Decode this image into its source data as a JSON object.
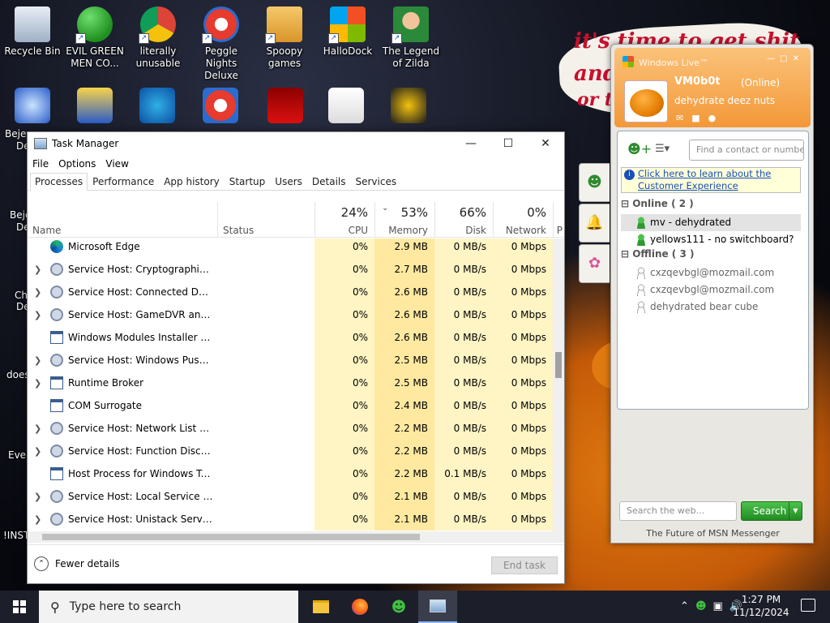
{
  "desktop": {
    "icons": [
      {
        "label": "Recycle Bin",
        "icon": "recycle-bin-icon"
      },
      {
        "label": "EVIL GREEN MEN CO...",
        "icon": "msn-buddies-icon"
      },
      {
        "label": "literally unusable",
        "icon": "chrome-icon"
      },
      {
        "label": "Peggle Nights Deluxe",
        "icon": "peggle-icon"
      },
      {
        "label": "Spoopy games",
        "icon": "folder-icon"
      },
      {
        "label": "HalloDock",
        "icon": "windows-logo-icon"
      },
      {
        "label": "The Legend of Zilda",
        "icon": "zilda-icon"
      }
    ],
    "partial_labels": [
      "Beje",
      "De",
      "Beje",
      "De",
      "Ch",
      "De",
      "does",
      "Ever",
      "!INST"
    ],
    "wallpaper_text": [
      "it's time to get shit",
      "and",
      "or t"
    ]
  },
  "task_manager": {
    "title": "Task Manager",
    "menu": [
      "File",
      "Options",
      "View"
    ],
    "tabs": [
      "Processes",
      "Performance",
      "App history",
      "Startup",
      "Users",
      "Details",
      "Services"
    ],
    "active_tab": "Processes",
    "columns": {
      "name": "Name",
      "status": "Status",
      "cpu": {
        "pct": "24%",
        "label": "CPU"
      },
      "memory": {
        "pct": "53%",
        "label": "Memory"
      },
      "disk": {
        "pct": "66%",
        "label": "Disk"
      },
      "network": {
        "pct": "0%",
        "label": "Network"
      },
      "power_partial": "P"
    },
    "rows": [
      {
        "name": "Microsoft Edge",
        "icon": "edge-icon",
        "expandable": false,
        "cpu": "0%",
        "memory": "2.9 MB",
        "disk": "0 MB/s",
        "network": "0 Mbps"
      },
      {
        "name": "Service Host: Cryptographic Ser...",
        "icon": "gear-icon",
        "expandable": true,
        "cpu": "0%",
        "memory": "2.7 MB",
        "disk": "0 MB/s",
        "network": "0 Mbps"
      },
      {
        "name": "Service Host: Connected Device...",
        "icon": "gear-icon",
        "expandable": true,
        "cpu": "0%",
        "memory": "2.6 MB",
        "disk": "0 MB/s",
        "network": "0 Mbps"
      },
      {
        "name": "Service Host: GameDVR and Bro...",
        "icon": "gear-icon",
        "expandable": true,
        "cpu": "0%",
        "memory": "2.6 MB",
        "disk": "0 MB/s",
        "network": "0 Mbps"
      },
      {
        "name": "Windows Modules Installer Wor...",
        "icon": "window-icon",
        "expandable": false,
        "cpu": "0%",
        "memory": "2.6 MB",
        "disk": "0 MB/s",
        "network": "0 Mbps"
      },
      {
        "name": "Service Host: Windows Push No...",
        "icon": "gear-icon",
        "expandable": true,
        "cpu": "0%",
        "memory": "2.5 MB",
        "disk": "0 MB/s",
        "network": "0 Mbps"
      },
      {
        "name": "Runtime Broker",
        "icon": "window-icon",
        "expandable": true,
        "cpu": "0%",
        "memory": "2.5 MB",
        "disk": "0 MB/s",
        "network": "0 Mbps"
      },
      {
        "name": "COM Surrogate",
        "icon": "window-icon",
        "expandable": false,
        "cpu": "0%",
        "memory": "2.4 MB",
        "disk": "0 MB/s",
        "network": "0 Mbps"
      },
      {
        "name": "Service Host: Network List Service",
        "icon": "gear-icon",
        "expandable": true,
        "cpu": "0%",
        "memory": "2.2 MB",
        "disk": "0 MB/s",
        "network": "0 Mbps"
      },
      {
        "name": "Service Host: Function Discover...",
        "icon": "gear-icon",
        "expandable": true,
        "cpu": "0%",
        "memory": "2.2 MB",
        "disk": "0 MB/s",
        "network": "0 Mbps"
      },
      {
        "name": "Host Process for Windows Tasks",
        "icon": "window-icon",
        "expandable": false,
        "cpu": "0%",
        "memory": "2.2 MB",
        "disk": "0.1 MB/s",
        "network": "0 Mbps"
      },
      {
        "name": "Service Host: Local Service (Net...",
        "icon": "gear-icon",
        "expandable": true,
        "cpu": "0%",
        "memory": "2.1 MB",
        "disk": "0 MB/s",
        "network": "0 Mbps"
      },
      {
        "name": "Service Host: Unistack Service G...",
        "icon": "gear-icon",
        "expandable": true,
        "cpu": "0%",
        "memory": "2.1 MB",
        "disk": "0 MB/s",
        "network": "0 Mbps"
      }
    ],
    "fewer_details": "Fewer details",
    "end_task": "End task"
  },
  "messenger": {
    "window_title": "Windows Live™",
    "user_name": "VM0b0t",
    "user_status": "(Online)",
    "personal_message": "dehydrate deez nuts",
    "search_placeholder": "Find a contact or numbe",
    "ad_text": [
      "Click here to learn about the",
      "Customer Experience"
    ],
    "groups": [
      {
        "label": "Online ( 2 )",
        "contacts": [
          "mv - dehydrated",
          "yellows111 - no switchboard?"
        ],
        "online": true
      },
      {
        "label": "Offline ( 3 )",
        "contacts": [
          "cxzqevbgl@mozmail.com",
          "cxzqevbgl@mozmail.com",
          "dehydrated bear cube"
        ],
        "online": false
      }
    ],
    "web_search_placeholder": "Search the web...",
    "search_button": "Search",
    "footer": "The Future of MSN Messenger"
  },
  "taskbar": {
    "search_placeholder": "Type here to search",
    "time": "1:27 PM",
    "date": "11/12/2024"
  }
}
